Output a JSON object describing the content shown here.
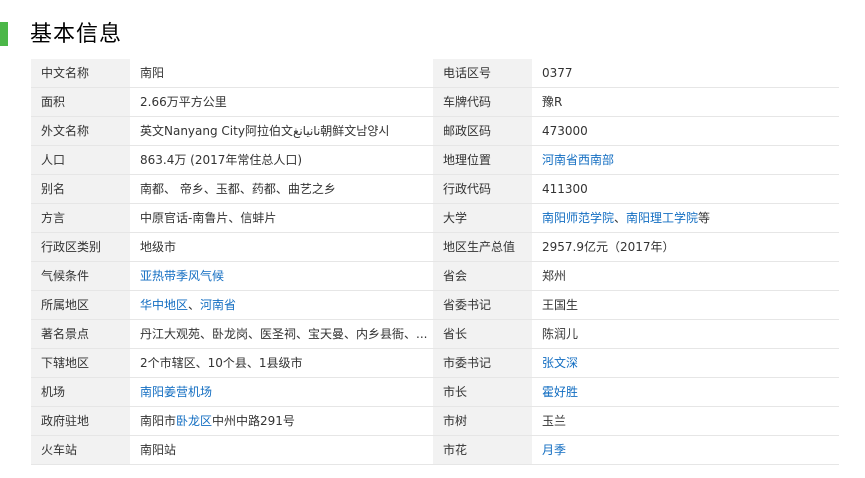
{
  "section_title": "基本信息",
  "accent_color": "#4bb748",
  "link_color": "#136ec2",
  "rows": [
    {
      "lk": "中文名称",
      "lv": [
        {
          "t": "南阳"
        }
      ],
      "rk": "电话区号",
      "rv": [
        {
          "t": "0377"
        }
      ]
    },
    {
      "lk": "面积",
      "lv": [
        {
          "t": "2.66万平方公里"
        }
      ],
      "rk": "车牌代码",
      "rv": [
        {
          "t": "豫R"
        }
      ]
    },
    {
      "lk": "外文名称",
      "lv": [
        {
          "t": "英文Nanyang City阿拉伯文نانيانغ朝鲜文남양시"
        }
      ],
      "rk": "邮政区码",
      "rv": [
        {
          "t": "473000"
        }
      ]
    },
    {
      "lk": "人口",
      "lv": [
        {
          "t": "863.4万 (2017年常住总人口)"
        }
      ],
      "rk": "地理位置",
      "rv": [
        {
          "t": "河南省西南部",
          "link": true
        }
      ]
    },
    {
      "lk": "别名",
      "lv": [
        {
          "t": "南都、 帝乡、玉都、药都、曲艺之乡"
        }
      ],
      "rk": "行政代码",
      "rv": [
        {
          "t": "411300"
        }
      ]
    },
    {
      "lk": "方言",
      "lv": [
        {
          "t": "中原官话-南鲁片、信蚌片"
        }
      ],
      "rk": "大学",
      "rv": [
        {
          "t": "南阳师范学院",
          "link": true
        },
        {
          "t": "、"
        },
        {
          "t": "南阳理工学院",
          "link": true
        },
        {
          "t": "等"
        }
      ]
    },
    {
      "lk": "行政区类别",
      "lv": [
        {
          "t": "地级市"
        }
      ],
      "rk": "地区生产总值",
      "rv": [
        {
          "t": "2957.9亿元（2017年）"
        }
      ]
    },
    {
      "lk": "气候条件",
      "lv": [
        {
          "t": "亚热带季风气候",
          "link": true
        }
      ],
      "rk": "省会",
      "rv": [
        {
          "t": "郑州"
        }
      ]
    },
    {
      "lk": "所属地区",
      "lv": [
        {
          "t": "华中地区",
          "link": true
        },
        {
          "t": "、"
        },
        {
          "t": "河南省",
          "link": true
        }
      ],
      "rk": "省委书记",
      "rv": [
        {
          "t": "王国生"
        }
      ]
    },
    {
      "lk": "著名景点",
      "lv": [
        {
          "t": "丹江大观苑、卧龙岗、医圣祠、宝天曼、内乡县衙、..."
        }
      ],
      "rk": "省长",
      "rv": [
        {
          "t": "陈润儿"
        }
      ]
    },
    {
      "lk": "下辖地区",
      "lv": [
        {
          "t": "2个市辖区、10个县、1县级市"
        }
      ],
      "rk": "市委书记",
      "rv": [
        {
          "t": "张文深",
          "link": true
        }
      ]
    },
    {
      "lk": "机场",
      "lv": [
        {
          "t": "南阳姜营机场",
          "link": true
        }
      ],
      "rk": "市长",
      "rv": [
        {
          "t": "霍好胜",
          "link": true
        }
      ]
    },
    {
      "lk": "政府驻地",
      "lv": [
        {
          "t": "南阳市"
        },
        {
          "t": "卧龙区",
          "link": true
        },
        {
          "t": "中州中路291号"
        }
      ],
      "rk": "市树",
      "rv": [
        {
          "t": "玉兰"
        }
      ]
    },
    {
      "lk": "火车站",
      "lv": [
        {
          "t": "南阳站"
        }
      ],
      "rk": "市花",
      "rv": [
        {
          "t": "月季",
          "link": true
        }
      ]
    }
  ]
}
